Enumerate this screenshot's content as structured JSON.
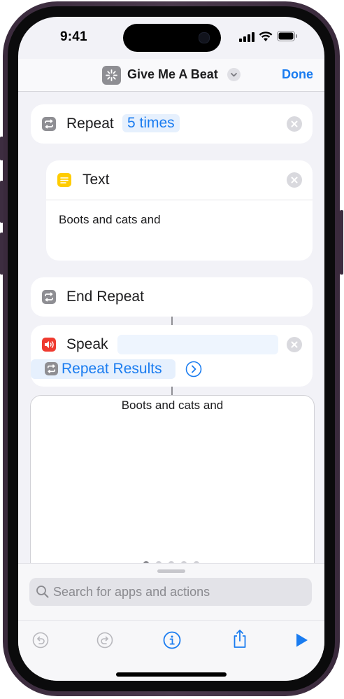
{
  "status_bar": {
    "time": "9:41"
  },
  "nav": {
    "title": "Give Me A Beat",
    "done": "Done"
  },
  "actions": {
    "repeat": {
      "label": "Repeat",
      "count": "5 times"
    },
    "text": {
      "label": "Text",
      "content": "Boots and cats and"
    },
    "end_repeat": {
      "label": "End Repeat"
    },
    "speak": {
      "label": "Speak",
      "variable": "Repeat Results"
    }
  },
  "result": {
    "output": "Boots and cats and",
    "page_dots": 5
  },
  "search": {
    "placeholder": "Search for apps and actions"
  },
  "toolbar": {
    "icons": [
      "undo-icon",
      "redo-icon",
      "info-icon",
      "share-icon",
      "play-icon"
    ]
  },
  "colors": {
    "accent": "#1a7cf0",
    "text_action": "#ffcc00",
    "speak_action": "#ef3b30",
    "control_action": "#8e8e93"
  }
}
